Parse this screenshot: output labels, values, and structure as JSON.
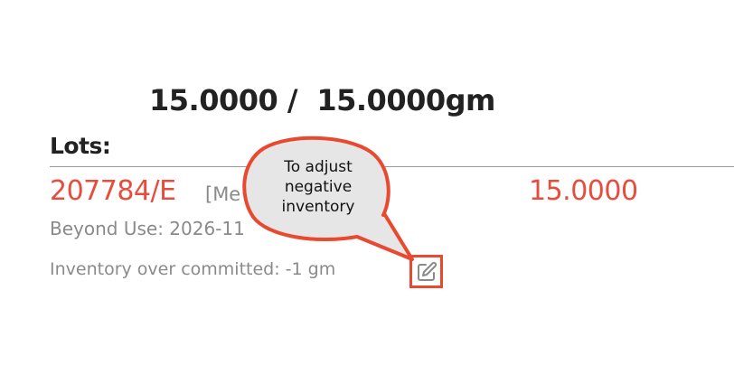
{
  "summary": {
    "quantity_text": "15.0000 /  15.0000gm"
  },
  "lots": {
    "heading": "Lots:",
    "items": [
      {
        "lot_id": "207784/E",
        "description": "[Me                         g)]",
        "quantity": "15.0000",
        "beyond_use": "Beyond Use: 2026-11",
        "inventory_note": "Inventory over committed: -1 gm"
      }
    ]
  },
  "callout": {
    "text": "To adjust negative inventory"
  },
  "icons": {
    "edit": "edit-pencil-icon"
  },
  "colors": {
    "accent": "#e84c3d",
    "highlight_border": "#e8492f",
    "callout_fill": "#e6e6e6",
    "callout_border": "#e8492f",
    "muted_text": "#8a8a8a",
    "heading_text": "#222222"
  }
}
